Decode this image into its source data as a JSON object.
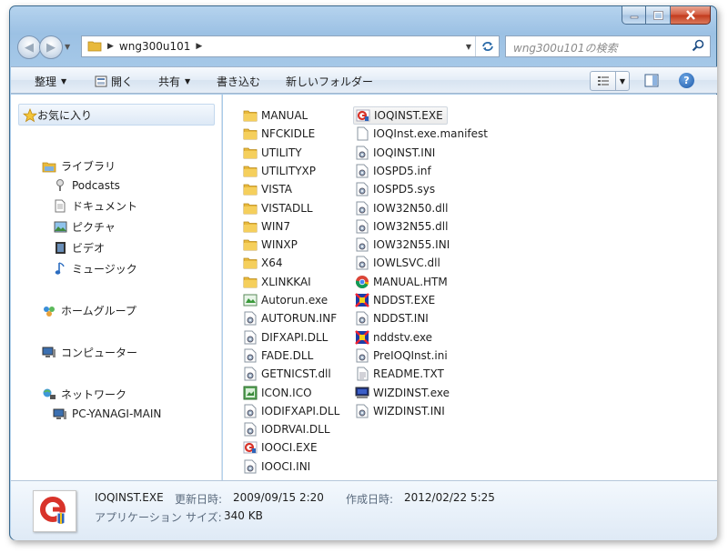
{
  "window": {
    "colors": {
      "frame": "#9cc1e4",
      "close": "#c2391c",
      "folder": "#e8b93c",
      "selection": "#ebebeb"
    }
  },
  "address": {
    "path": [
      "wng300u101"
    ],
    "search_placeholder": "wng300u101の検索"
  },
  "toolbar": {
    "organize": "整理",
    "open": "開く",
    "share": "共有",
    "burn": "書き込む",
    "new_folder": "新しいフォルダー"
  },
  "nav": {
    "favorites": "お気に入り",
    "libraries": "ライブラリ",
    "podcasts": "Podcasts",
    "documents": "ドキュメント",
    "pictures": "ピクチャ",
    "videos": "ビデオ",
    "music": "ミュージック",
    "homegroup": "ホームグループ",
    "computer": "コンピューター",
    "network": "ネットワーク",
    "pc": "PC-YANAGI-MAIN"
  },
  "files": {
    "col1": [
      {
        "name": "MANUAL",
        "icon": "folder"
      },
      {
        "name": "NFCKIDLE",
        "icon": "folder"
      },
      {
        "name": "UTILITY",
        "icon": "folder"
      },
      {
        "name": "UTILITYXP",
        "icon": "folder"
      },
      {
        "name": "VISTA",
        "icon": "folder"
      },
      {
        "name": "VISTADLL",
        "icon": "folder"
      },
      {
        "name": "WIN7",
        "icon": "folder"
      },
      {
        "name": "WINXP",
        "icon": "folder"
      },
      {
        "name": "X64",
        "icon": "folder"
      },
      {
        "name": "XLINKKAI",
        "icon": "folder"
      },
      {
        "name": "Autorun.exe",
        "icon": "exe-green"
      },
      {
        "name": "AUTORUN.INF",
        "icon": "gear"
      },
      {
        "name": "DIFXAPI.DLL",
        "icon": "gear"
      },
      {
        "name": "FADE.DLL",
        "icon": "gear"
      },
      {
        "name": "GETNICST.dll",
        "icon": "gear"
      },
      {
        "name": "ICON.ICO",
        "icon": "ico"
      },
      {
        "name": "IODIFXAPI.DLL",
        "icon": "gear"
      },
      {
        "name": "IODRVAI.DLL",
        "icon": "gear"
      },
      {
        "name": "IOOCI.EXE",
        "icon": "exe-red"
      },
      {
        "name": "IOOCI.INI",
        "icon": "gear"
      }
    ],
    "col2": [
      {
        "name": "IOQINST.EXE",
        "icon": "exe-red"
      },
      {
        "name": "IOQInst.exe.manifest",
        "icon": "doc"
      },
      {
        "name": "IOQINST.INI",
        "icon": "gear"
      },
      {
        "name": "IOSPD5.inf",
        "icon": "gear"
      },
      {
        "name": "IOSPD5.sys",
        "icon": "gear"
      },
      {
        "name": "IOW32N50.dll",
        "icon": "gear"
      },
      {
        "name": "IOW32N55.dll",
        "icon": "gear"
      },
      {
        "name": "IOW32N55.INI",
        "icon": "gear"
      },
      {
        "name": "IOWLSVC.dll",
        "icon": "gear"
      },
      {
        "name": "MANUAL.HTM",
        "icon": "chrome"
      },
      {
        "name": "NDDST.EXE",
        "icon": "exe-color"
      },
      {
        "name": "NDDST.INI",
        "icon": "gear"
      },
      {
        "name": "nddstv.exe",
        "icon": "exe-color"
      },
      {
        "name": "PreIOQInst.ini",
        "icon": "gear"
      },
      {
        "name": "README.TXT",
        "icon": "txt"
      },
      {
        "name": "WIZDINST.exe",
        "icon": "exe-monitor"
      },
      {
        "name": "WIZDINST.INI",
        "icon": "gear"
      }
    ]
  },
  "details": {
    "name": "IOQINST.EXE",
    "type": "アプリケーション",
    "modified_label": "更新日時:",
    "modified": "2009/09/15 2:20",
    "size_label": "サイズ:",
    "size": "340 KB",
    "created_label": "作成日時:",
    "created": "2012/02/22 5:25"
  }
}
